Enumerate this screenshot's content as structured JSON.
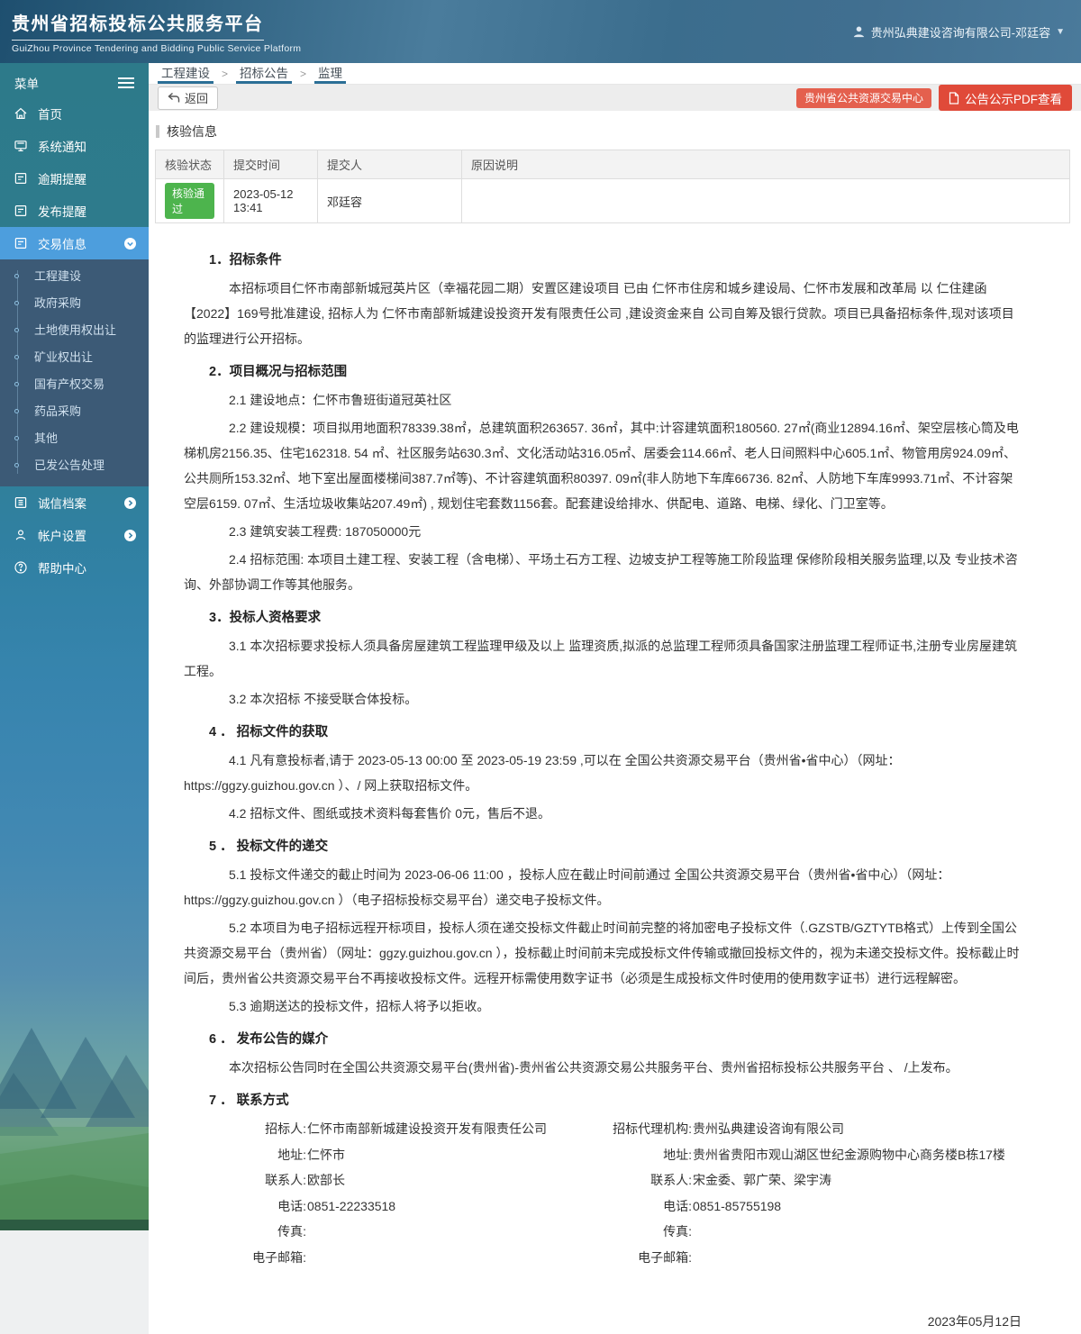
{
  "colors": {
    "accent_red": "#e04a39",
    "accent_red_light": "#e4604e",
    "status_green": "#4db44d",
    "active_blue": "#4d9edd",
    "sidebar_teal": "#2e7c8e",
    "submenu_blue": "#3c5a76",
    "crumb_underline": "#2b6f96"
  },
  "header": {
    "title": "贵州省招标投标公共服务平台",
    "subtitle": "GuiZhou Province Tendering and Bidding Public Service Platform",
    "user": "贵州弘典建设咨询有限公司-邓廷容",
    "user_icon": "user-icon",
    "caret_icon": "chevron-down-icon"
  },
  "sidebar": {
    "menu_label": "菜单",
    "menu_icon": "hamburger-icon",
    "items": [
      {
        "label": "首页",
        "icon": "home-icon"
      },
      {
        "label": "系统通知",
        "icon": "monitor-icon"
      },
      {
        "label": "逾期提醒",
        "icon": "form-icon"
      },
      {
        "label": "发布提醒",
        "icon": "form-icon"
      },
      {
        "label": "交易信息",
        "icon": "form-icon",
        "active": true,
        "chevron": "chevron-down-circle-icon"
      }
    ],
    "submenu": [
      {
        "label": "工程建设"
      },
      {
        "label": "政府采购"
      },
      {
        "label": "土地使用权出让"
      },
      {
        "label": "矿业权出让"
      },
      {
        "label": "国有产权交易"
      },
      {
        "label": "药品采购"
      },
      {
        "label": "其他"
      },
      {
        "label": "已发公告处理"
      }
    ],
    "bottom_items": [
      {
        "label": "诚信档案",
        "icon": "list-icon",
        "chevron": "chevron-right-circle-icon"
      },
      {
        "label": "帐户设置",
        "icon": "person-icon",
        "chevron": "chevron-right-circle-icon"
      },
      {
        "label": "帮助中心",
        "icon": "question-circle-icon"
      }
    ]
  },
  "breadcrumb": {
    "items": [
      {
        "label": "工程建设"
      },
      {
        "label": "招标公告"
      },
      {
        "label": "监理"
      }
    ],
    "separator": ">"
  },
  "toolbar": {
    "back_label": "返回",
    "back_icon": "back-icon",
    "center_button_label": "贵州省公共资源交易中心",
    "pdf_button_label": "公告公示PDF查看",
    "pdf_icon": "pdf-file-icon"
  },
  "verify": {
    "section_title": "核验信息",
    "columns": [
      "核验状态",
      "提交时间",
      "提交人",
      "原因说明"
    ],
    "row": {
      "status": "核验通过",
      "time": "2023-05-12 13:41",
      "submitter": "邓廷容",
      "reason": ""
    }
  },
  "document": {
    "blocks": [
      {
        "t": "h",
        "text": "1．招标条件"
      },
      {
        "t": "p",
        "text": "本招标项目仁怀市南部新城冠英片区（幸福花园二期）安置区建设项目 已由 仁怀市住房和城乡建设局、仁怀市发展和改革局 以 仁住建函【2022】169号批准建设, 招标人为 仁怀市南部新城建设投资开发有限责任公司 ,建设资金来自 公司自筹及银行贷款。项目已具备招标条件,现对该项目的监理进行公开招标。"
      },
      {
        "t": "h",
        "text": "2．项目概况与招标范围"
      },
      {
        "t": "p",
        "text": "2.1 建设地点：仁怀市鲁班街道冠英社区"
      },
      {
        "t": "p",
        "text": "2.2 建设规模：项目拟用地面积78339.38㎡，总建筑面积263657. 36㎡，其中:计容建筑面积180560. 27㎡(商业12894.16㎡、架空层核心筒及电梯机房2156.35、住宅162318. 54 ㎡、社区服务站630.3㎡、文化活动站316.05㎡、居委会114.66㎡、老人日间照料中心605.1㎡、物管用房924.09㎡、公共厕所153.32㎡、地下室出屋面楼梯间387.7㎡等)、不计容建筑面积80397. 09㎡(非人防地下车库66736. 82㎡、人防地下车库9993.71㎡、不计容架空层6159. 07㎡、生活垃圾收集站207.49㎡) , 规划住宅套数1156套。配套建设给排水、供配电、道路、电梯、绿化、门卫室等。"
      },
      {
        "t": "p",
        "text": "2.3 建筑安装工程费: 187050000元"
      },
      {
        "t": "p",
        "text": "2.4 招标范围: 本项目土建工程、安装工程（含电梯）、平场土石方工程、边坡支护工程等施工阶段监理 保修阶段相关服务监理,以及 专业技术咨询、外部协调工作等其他服务。"
      },
      {
        "t": "h",
        "text": "3．投标人资格要求"
      },
      {
        "t": "p",
        "text": "3.1 本次招标要求投标人须具备房屋建筑工程监理甲级及以上 监理资质,拟派的总监理工程师须具备国家注册监理工程师证书,注册专业房屋建筑工程。"
      },
      {
        "t": "p",
        "text": "3.2 本次招标 不接受联合体投标。"
      },
      {
        "t": "h",
        "text": "4 ． 招标文件的获取"
      },
      {
        "t": "p",
        "text": "4.1 凡有意投标者,请于 2023-05-13 00:00 至 2023-05-19 23:59 ,可以在 全国公共资源交易平台（贵州省•省中心）（网址：https://ggzy.guizhou.gov.cn ）、/ 网上获取招标文件。"
      },
      {
        "t": "p",
        "text": "4.2 招标文件、图纸或技术资料每套售价 0元，售后不退。"
      },
      {
        "t": "h",
        "text": "5 ． 投标文件的递交"
      },
      {
        "t": "p",
        "text": "5.1 投标文件递交的截止时间为 2023-06-06 11:00 ，投标人应在截止时间前通过 全国公共资源交易平台（贵州省•省中心）（网址：https://ggzy.guizhou.gov.cn ）（电子招标投标交易平台）递交电子投标文件。"
      },
      {
        "t": "p",
        "text": "5.2 本项目为电子招标远程开标项目，投标人须在递交投标文件截止时间前完整的将加密电子投标文件（.GZSTB/GZTYTB格式）上传到全国公共资源交易平台（贵州省）（网址：ggzy.guizhou.gov.cn ），投标截止时间前未完成投标文件传输或撤回投标文件的，视为未递交投标文件。投标截止时间后，贵州省公共资源交易平台不再接收投标文件。远程开标需使用数字证书（必须是生成投标文件时使用的使用数字证书）进行远程解密。"
      },
      {
        "t": "p",
        "text": "5.3 逾期送达的投标文件，招标人将予以拒收。"
      },
      {
        "t": "h",
        "text": "6 ． 发布公告的媒介"
      },
      {
        "t": "p",
        "text": "本次招标公告同时在全国公共资源交易平台(贵州省)-贵州省公共资源交易公共服务平台、贵州省招标投标公共服务平台 、 /上发布。"
      },
      {
        "t": "h",
        "text": "7 ． 联系方式"
      }
    ],
    "contacts": {
      "left": [
        {
          "label": "招标人:",
          "value": "仁怀市南部新城建设投资开发有限责任公司"
        },
        {
          "label": "地址:",
          "value": "仁怀市"
        },
        {
          "label": "联系人:",
          "value": "欧部长"
        },
        {
          "label": "电话:",
          "value": "0851-22233518"
        },
        {
          "label": "传真:",
          "value": ""
        },
        {
          "label": "电子邮箱:",
          "value": ""
        }
      ],
      "right": [
        {
          "label": "招标代理机构:",
          "value": "贵州弘典建设咨询有限公司"
        },
        {
          "label": "地址:",
          "value": "贵州省贵阳市观山湖区世纪金源购物中心商务楼B栋17楼"
        },
        {
          "label": "联系人:",
          "value": "宋金委、郭广荣、梁宇涛"
        },
        {
          "label": "电话:",
          "value": "0851-85755198"
        },
        {
          "label": "传真:",
          "value": ""
        },
        {
          "label": "电子邮箱:",
          "value": ""
        }
      ]
    },
    "date": "2023年05月12日"
  }
}
